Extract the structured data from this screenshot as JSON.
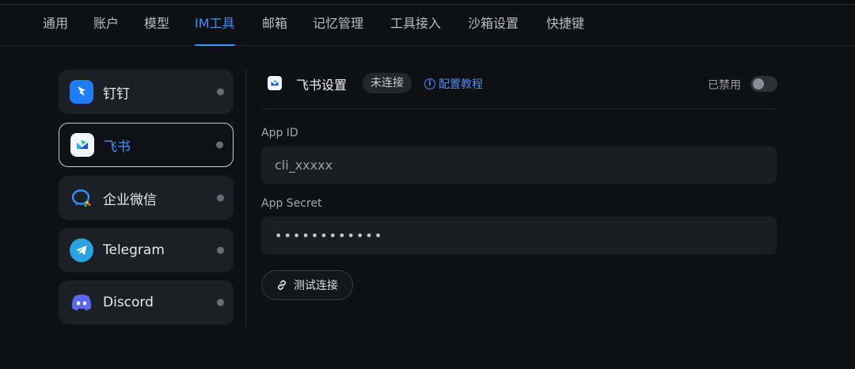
{
  "tabs": [
    {
      "label": "通用"
    },
    {
      "label": "账户"
    },
    {
      "label": "模型"
    },
    {
      "label": "IM工具",
      "active": true
    },
    {
      "label": "邮箱"
    },
    {
      "label": "记忆管理"
    },
    {
      "label": "工具接入"
    },
    {
      "label": "沙箱设置"
    },
    {
      "label": "快捷键"
    }
  ],
  "sidebar": {
    "items": [
      {
        "label": "钉钉",
        "icon": "dingtalk-icon"
      },
      {
        "label": "飞书",
        "icon": "feishu-icon",
        "active": true
      },
      {
        "label": "企业微信",
        "icon": "wecom-icon"
      },
      {
        "label": "Telegram",
        "icon": "telegram-icon"
      },
      {
        "label": "Discord",
        "icon": "discord-icon"
      }
    ]
  },
  "panel": {
    "title": "飞书设置",
    "status_badge": "未连接",
    "tutorial_link": "配置教程",
    "disabled_label": "已禁用",
    "toggle_on": false,
    "app_id": {
      "label": "App ID",
      "placeholder": "cli_xxxxx",
      "value": ""
    },
    "app_secret": {
      "label": "App Secret",
      "value": "••••••••••••"
    },
    "test_button": "测试连接"
  },
  "colors": {
    "accent": "#4b8df8",
    "background": "#0f1014",
    "card": "#1d1f26",
    "status_dot": "#6a6d75"
  }
}
